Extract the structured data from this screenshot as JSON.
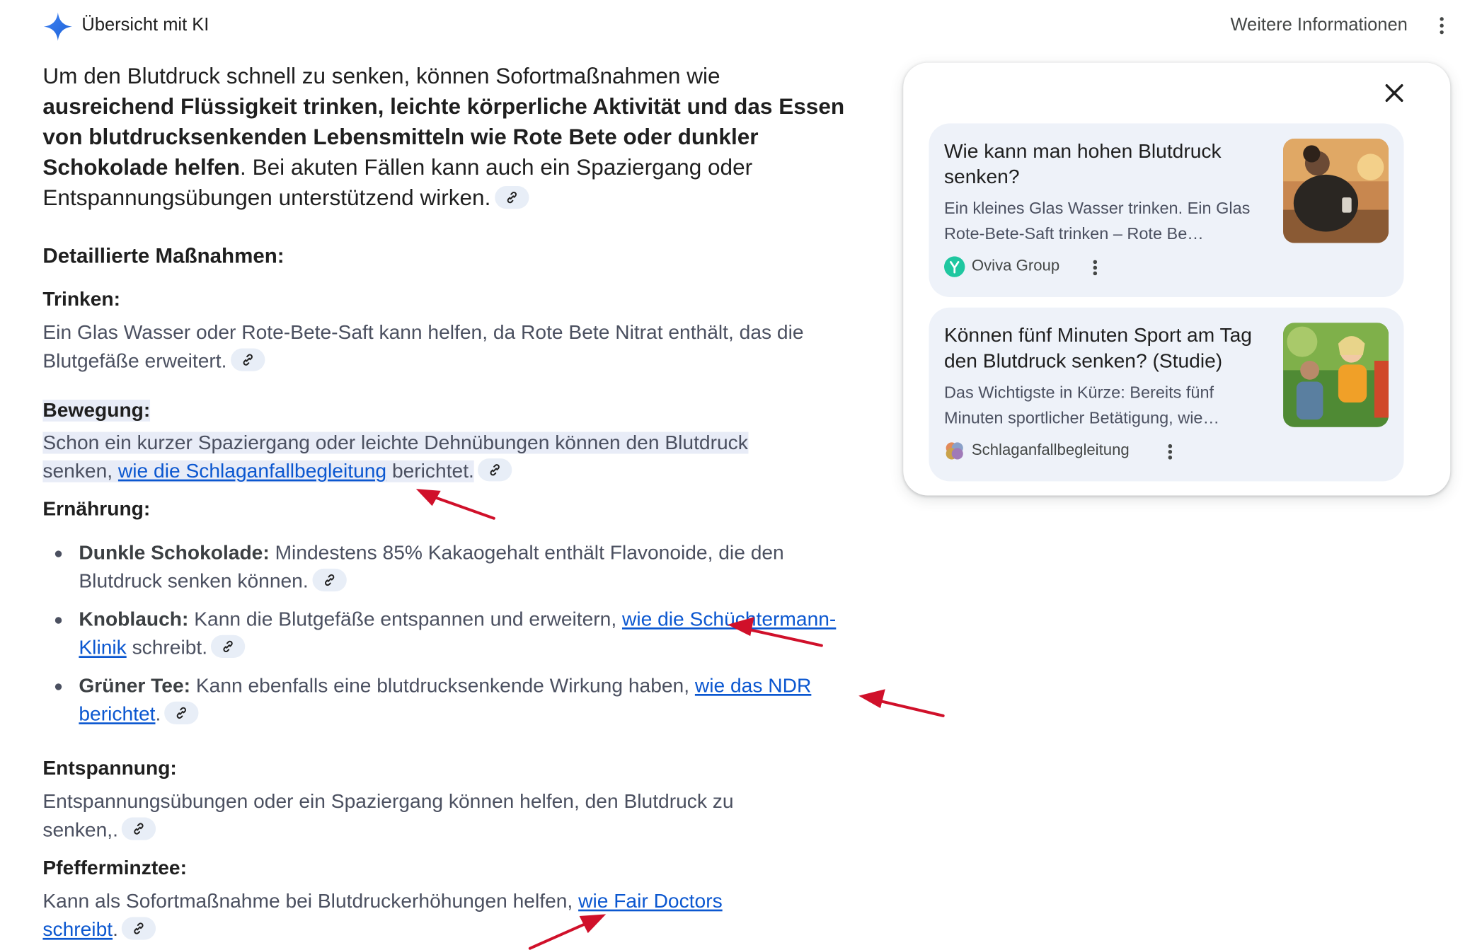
{
  "header": {
    "title": "Übersicht mit KI",
    "more_info": "Weitere Informationen"
  },
  "intro": {
    "t1": "Um den Blutdruck schnell zu senken, können Sofortmaßnahmen wie ",
    "b1": "ausreichend Flüssigkeit trinken, leichte körperliche Aktivität und das Essen von blutdrucksenkenden Lebensmitteln wie Rote Bete oder dunkler Schokolade helfen",
    "t2": ". Bei akuten Fällen kann auch ein Spaziergang oder Entspannungsübungen unterstützend wirken."
  },
  "details_heading": "Detaillierte Maßnahmen:",
  "trinken": {
    "heading": "Trinken:",
    "text": "Ein Glas Wasser oder Rote-Bete-Saft kann helfen, da Rote Bete Nitrat enthält, das die Blutgefäße erweitert."
  },
  "bewegung": {
    "heading": "Bewegung:",
    "text1": "Schon ein kurzer Spaziergang oder leichte Dehnübungen können den Blutdruck senken, ",
    "link": "wie die Schlaganfallbegleitung",
    "text2": " berichtet."
  },
  "ernaehrung": {
    "heading": "Ernährung:",
    "items": [
      {
        "label": "Dunkle Schokolade:",
        "text": " Mindestens 85% Kakaogehalt enthält Flavonoide, die den Blutdruck senken können.",
        "link": "",
        "after": ""
      },
      {
        "label": "Knoblauch:",
        "text": " Kann die Blutgefäße entspannen und erweitern, ",
        "link": "wie die Schüchtermann-Klinik",
        "after": " schreibt."
      },
      {
        "label": "Grüner Tee:",
        "text": " Kann ebenfalls eine blutdrucksenkende Wirkung haben, ",
        "link": "wie das NDR berichtet",
        "after": "."
      }
    ]
  },
  "entspannung": {
    "heading": "Entspannung:",
    "text": "Entspannungsübungen oder ein Spaziergang können helfen, den Blutdruck zu senken,."
  },
  "pfefferminz": {
    "heading": "Pfefferminztee:",
    "text": "Kann als Sofortmaßnahme bei Blutdruckerhöhungen helfen, ",
    "link": "wie Fair Doctors schreibt",
    "after": "."
  },
  "sources": [
    {
      "title": "Wie kann man hohen Blutdruck senken?",
      "snippet": "Ein kleines Glas Wasser trinken. Ein Glas Rote-Bete-Saft trinken – Rote Be…",
      "source": "Oviva Group",
      "favicon_color": "#1fc7a0"
    },
    {
      "title": "Können fünf Minuten Sport am Tag den Blutdruck senken? (Studie)",
      "snippet": "Das Wichtigste in Kürze: Bereits fünf Minuten sportlicher Betätigung, wie…",
      "source": "Schlaganfallbegleitung",
      "favicon_color": "#c98a5a"
    }
  ],
  "colors": {
    "link": "#0b57d0",
    "highlight": "#e8ecf7",
    "arrow": "#d0102a",
    "card_bg": "#eef2f9"
  }
}
